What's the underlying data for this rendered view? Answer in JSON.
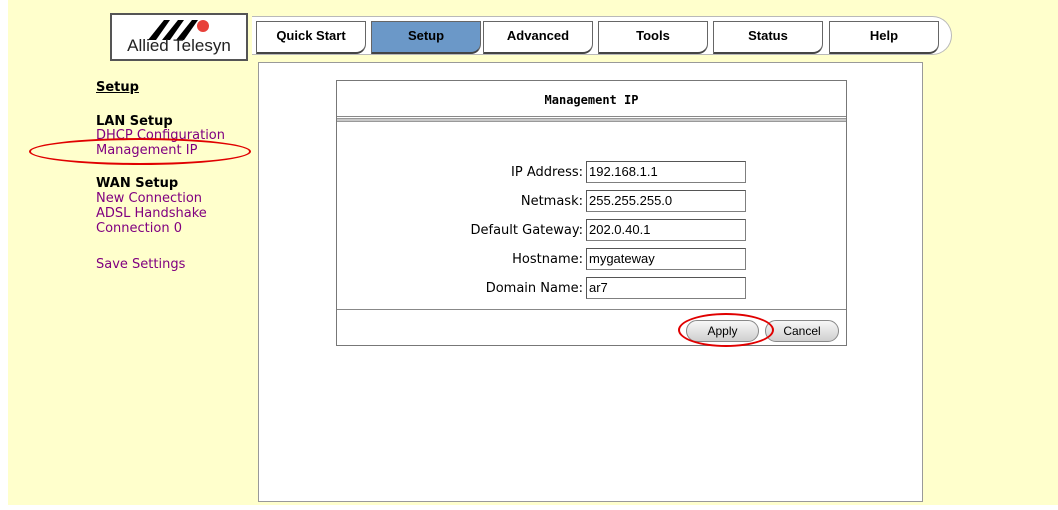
{
  "logo": {
    "text": "Allied Telesyn"
  },
  "nav": {
    "tabs": [
      {
        "label": "Quick Start"
      },
      {
        "label": "Setup"
      },
      {
        "label": "Advanced"
      },
      {
        "label": "Tools"
      },
      {
        "label": "Status"
      },
      {
        "label": "Help"
      }
    ],
    "active": "Setup"
  },
  "sidebar": {
    "title": "Setup",
    "lan_header": "LAN Setup",
    "lan_items": [
      "DHCP Configuration",
      "Management IP"
    ],
    "wan_header": "WAN Setup",
    "wan_items": [
      "New Connection",
      "ADSL Handshake",
      "Connection 0"
    ],
    "save": "Save Settings"
  },
  "form": {
    "title": "Management IP",
    "fields": [
      {
        "label": "IP Address:",
        "value": "192.168.1.1"
      },
      {
        "label": "Netmask:",
        "value": "255.255.255.0"
      },
      {
        "label": "Default Gateway:",
        "value": "202.0.40.1"
      },
      {
        "label": "Hostname:",
        "value": "mygateway"
      },
      {
        "label": "Domain Name:",
        "value": "ar7"
      }
    ],
    "apply": "Apply",
    "cancel": "Cancel"
  },
  "colors": {
    "page_bg": "#ffffcc",
    "active_tab": "#6b98c8",
    "link": "#800080",
    "highlight": "#e00000"
  }
}
